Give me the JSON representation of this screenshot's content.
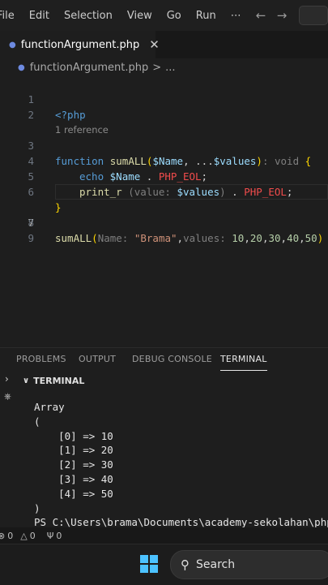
{
  "menubar": {
    "items": [
      "File",
      "Edit",
      "Selection",
      "View",
      "Go",
      "Run",
      "⋯"
    ],
    "back_icon": "arrow-left-icon",
    "forward_icon": "arrow-right-icon"
  },
  "tab": {
    "icon": "php-elephant-icon",
    "label": "functionArgument.php",
    "close": "✕"
  },
  "breadcrumb": {
    "file": "functionArgument.php",
    "separator": ">",
    "more": "..."
  },
  "editor": {
    "codelens": "1 reference",
    "line_numbers": [
      "1",
      "2",
      "3",
      "4",
      "5",
      "6",
      "7",
      "8",
      "9"
    ],
    "lines": {
      "l1": {
        "open": "<?php"
      },
      "l3": {
        "kw": "function",
        "name": "sumALL",
        "p1": "(",
        "a1": "$Name",
        "c1": ", ",
        "spread": "...",
        "a2": "$values",
        "p2": ")",
        "rt": ": void ",
        "brace": "{"
      },
      "l4": {
        "kw": "echo",
        "var": "$Name",
        "dot": " . ",
        "const": "PHP_EOL",
        "semi": ";"
      },
      "l5": {
        "fn": "print_r",
        "p1": " (",
        "hint": "value: ",
        "var": "$values",
        "p2": ")",
        "dot": " . ",
        "const": "PHP_EOL",
        "semi": ";"
      },
      "l6": {
        "brace": "}"
      },
      "l8": {
        "fn": "sumALL",
        "p1": "(",
        "hint1": "Name: ",
        "str": "\"Brama\"",
        "comma": ",",
        "hint2": "values: ",
        "n1": "10",
        "n2": "20",
        "n3": "30",
        "n4": "40",
        "n5": "50",
        "sep": ",",
        "p2": ")"
      }
    }
  },
  "panel": {
    "tabs": [
      "PROBLEMS",
      "OUTPUT",
      "DEBUG CONSOLE",
      "TERMINAL"
    ],
    "active_tab": "TERMINAL",
    "section_title": "TERMINAL"
  },
  "terminal": {
    "lines": [
      "Array",
      "(",
      "    [0] => 10",
      "    [1] => 20",
      "    [2] => 30",
      "    [3] => 40",
      "    [4] => 50",
      ")",
      "PS C:\\Users\\brama\\Documents\\academy-sekolahan\\php\\"
    ]
  },
  "statusbar": {
    "errors": "0",
    "warnings": "0",
    "ports": "0"
  },
  "taskbar": {
    "search_label": "Search"
  },
  "colors": {
    "editor_bg": "#1e1e1e",
    "keyword": "#569cd6",
    "function": "#dcdcaa",
    "variable": "#9cdcfe",
    "constant": "#f14c4c",
    "string": "#ce9178",
    "number": "#b5cea8",
    "accent": "#4cc2ff"
  }
}
